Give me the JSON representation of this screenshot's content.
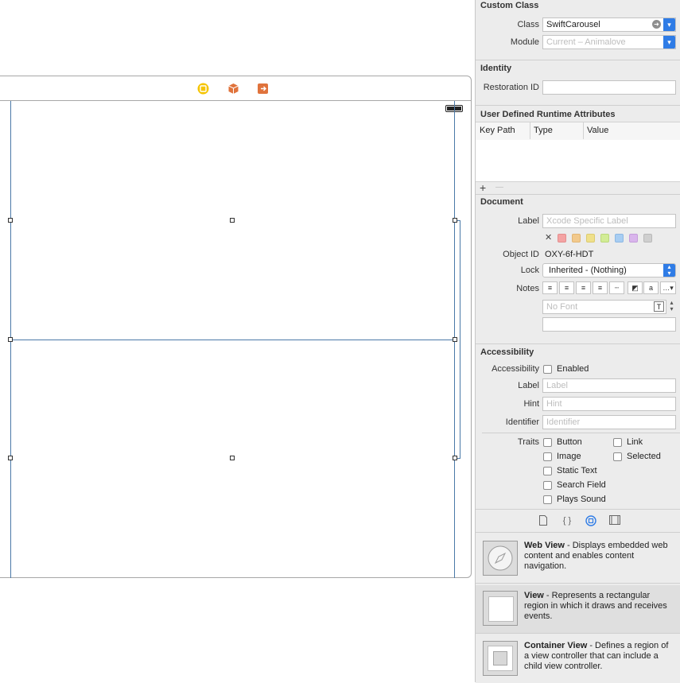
{
  "custom_class": {
    "title": "Custom Class",
    "class_label": "Class",
    "class_value": "SwiftCarousel",
    "module_label": "Module",
    "module_placeholder": "Current – Animalove"
  },
  "identity": {
    "title": "Identity",
    "restoration_label": "Restoration ID",
    "restoration_value": ""
  },
  "runtime_attributes": {
    "title": "User Defined Runtime Attributes",
    "columns": [
      "Key Path",
      "Type",
      "Value"
    ],
    "add_label": "+",
    "remove_label": "—"
  },
  "document": {
    "title": "Document",
    "label_label": "Label",
    "label_placeholder": "Xcode Specific Label",
    "clear_color_label": "✕",
    "swatches": [
      "#f4a3a3",
      "#f2c98c",
      "#efe08a",
      "#d2ec96",
      "#a7cdf2",
      "#d9b5ec",
      "#cfcfcf"
    ],
    "object_id_label": "Object ID",
    "object_id_value": "OXY-6f-HDT",
    "lock_label": "Lock",
    "lock_value": "Inherited - (Nothing)",
    "notes_label": "Notes",
    "font_placeholder": "No Font",
    "notes_value": ""
  },
  "accessibility": {
    "title": "Accessibility",
    "accessibility_label": "Accessibility",
    "enabled_label": "Enabled",
    "label_label": "Label",
    "label_placeholder": "Label",
    "hint_label": "Hint",
    "hint_placeholder": "Hint",
    "identifier_label": "Identifier",
    "identifier_placeholder": "Identifier",
    "traits_label": "Traits",
    "traits": [
      "Button",
      "Link",
      "Image",
      "Selected",
      "Static Text",
      "Search Field",
      "Plays Sound"
    ]
  },
  "library": {
    "items": [
      {
        "name": "Web View",
        "description": " - Displays embedded web content and enables content navigation."
      },
      {
        "name": "View",
        "description": " - Represents a rectangular region in which it draws and receives events."
      },
      {
        "name": "Container View",
        "description": " - Defines a region of a view controller that can include a child view controller."
      }
    ]
  },
  "icons": {
    "scene_dock": [
      "view-controller-icon",
      "first-responder-icon",
      "exit-icon"
    ],
    "library_tabs": [
      "file-template-icon",
      "code-snippet-icon",
      "object-library-icon",
      "media-library-icon"
    ]
  },
  "colors": {
    "accent": "#2f7ce6",
    "view_controller_icon": "#f5c400",
    "first_responder_icon": "#e0733c",
    "exit_icon": "#e0733c",
    "selection_line": "#4a79a8"
  }
}
